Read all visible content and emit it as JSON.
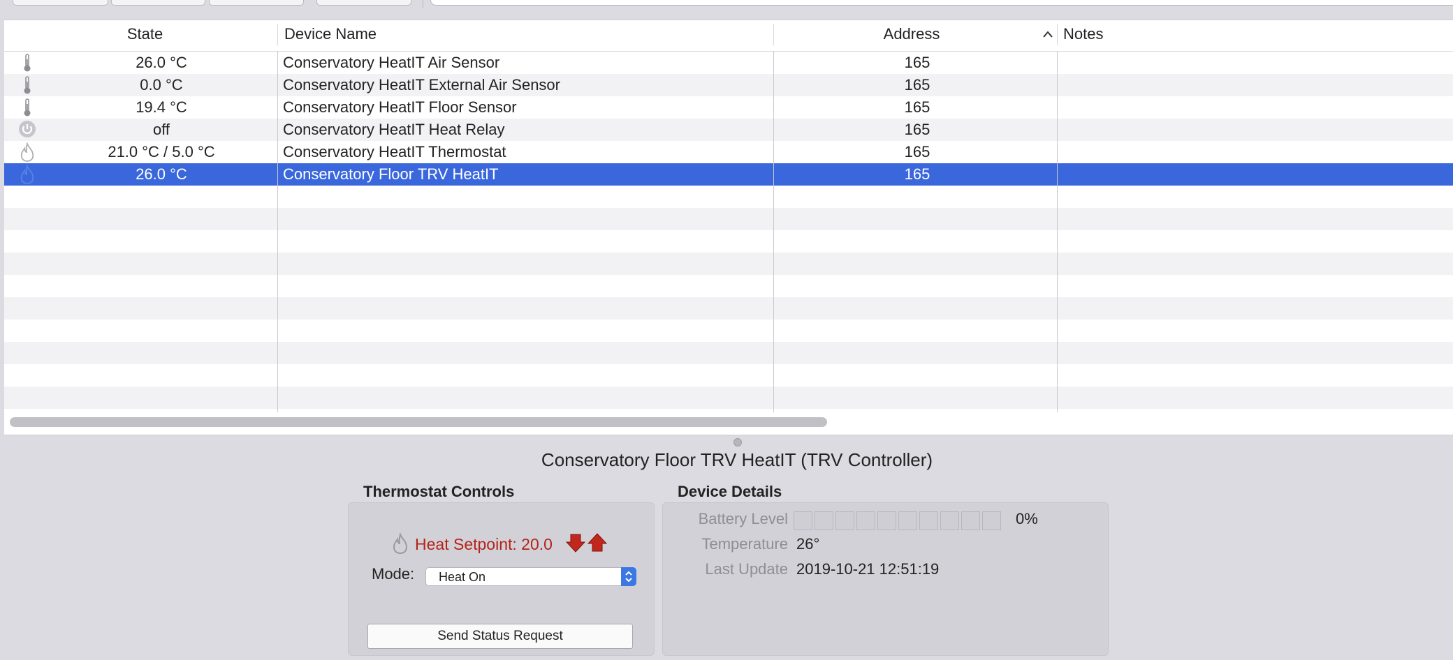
{
  "table": {
    "columns": [
      {
        "key": "state",
        "label": "State"
      },
      {
        "key": "name",
        "label": "Device Name"
      },
      {
        "key": "address",
        "label": "Address"
      },
      {
        "key": "notes",
        "label": "Notes"
      }
    ],
    "sort_column": "address",
    "sort_direction": "ascending",
    "rows": [
      {
        "icon": "thermometer-icon",
        "state": "26.0 °C",
        "name": "Conservatory HeatIT Air Sensor",
        "address": "165",
        "notes": ""
      },
      {
        "icon": "thermometer-icon",
        "state": "0.0 °C",
        "name": "Conservatory HeatIT External Air Sensor",
        "address": "165",
        "notes": ""
      },
      {
        "icon": "thermometer-icon",
        "state": "19.4 °C",
        "name": "Conservatory HeatIT Floor Sensor",
        "address": "165",
        "notes": ""
      },
      {
        "icon": "power-icon",
        "state": "off",
        "name": "Conservatory HeatIT Heat Relay",
        "address": "165",
        "notes": ""
      },
      {
        "icon": "flame-icon",
        "state": "21.0 °C / 5.0 °C",
        "name": "Conservatory HeatIT Thermostat",
        "address": "165",
        "notes": ""
      },
      {
        "icon": "flame-icon",
        "state": "26.0 °C",
        "name": "Conservatory Floor TRV HeatIT",
        "address": "165",
        "notes": "",
        "selected": true
      }
    ]
  },
  "detail": {
    "title": "Conservatory Floor TRV HeatIT (TRV Controller)",
    "thermostat": {
      "group_label": "Thermostat Controls",
      "setpoint_label": "Heat Setpoint: 20.0",
      "setpoint_color": "#b4231a",
      "mode_label": "Mode:",
      "mode_value": "Heat On",
      "send_button": "Send Status Request"
    },
    "device": {
      "group_label": "Device Details",
      "battery_label": "Battery Level",
      "battery_value": "0%",
      "battery_fraction": 0,
      "battery_segments": 10,
      "temperature_label": "Temperature",
      "temperature_value": "26°",
      "last_update_label": "Last Update",
      "last_update_value": "2019-10-21 12:51:19"
    }
  },
  "colors": {
    "selection": "#3a67dc",
    "alt_row": "#f2f2f5",
    "background": "#dcdbe1"
  }
}
